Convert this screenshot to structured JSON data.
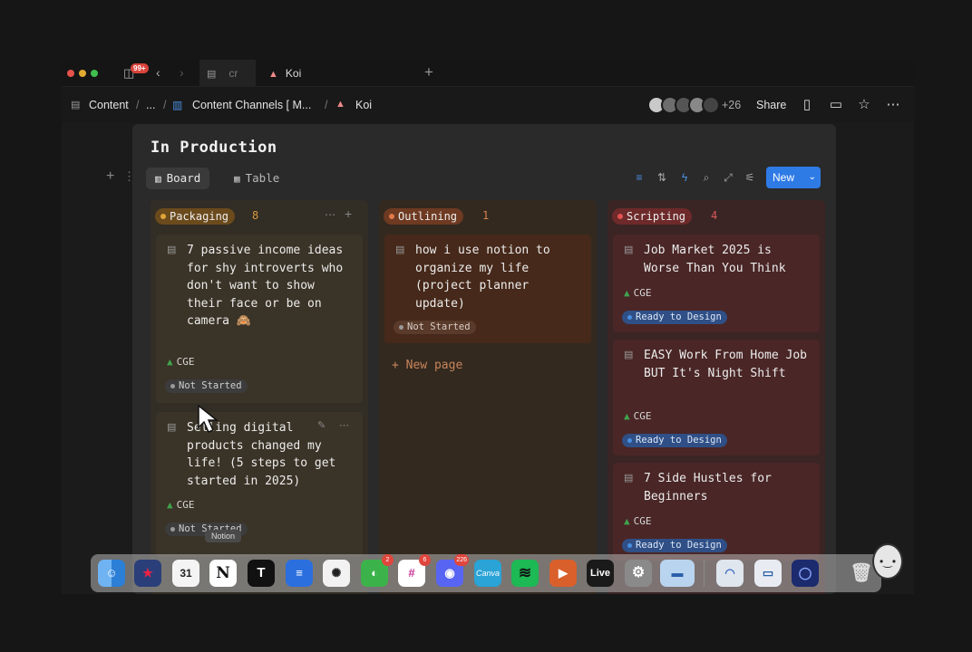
{
  "tabbar": {
    "notifications_badge": "99+",
    "tabs": [
      {
        "label": "cr"
      },
      {
        "label": "Koi"
      }
    ]
  },
  "breadcrumb": {
    "items": [
      "Content",
      "...",
      "Content Channels [ M...",
      "Koi"
    ],
    "extra_collaborators": "+26",
    "share_label": "Share"
  },
  "page": {
    "title": "In Production",
    "views": [
      {
        "label": "Board",
        "active": true
      },
      {
        "label": "Table",
        "active": false
      }
    ],
    "new_button": "New"
  },
  "columns": [
    {
      "name": "Packaging",
      "count": "8",
      "pill_bg": "#6b4a1c",
      "pill_dot": "#e0a53a",
      "count_color": "#d59a3f",
      "col_bg": "#322d25",
      "card_bg": "#3a3327",
      "cards": [
        {
          "title": "7 passive income ideas for shy introverts who don't want to show their face or be on camera 🙈",
          "owner": "CGE",
          "status": "Not Started"
        },
        {
          "title": "Selling digital products changed my life! (5 steps to get started in 2025)",
          "owner": "CGE",
          "status": "Not Started"
        }
      ]
    },
    {
      "name": "Outlining",
      "count": "1",
      "pill_bg": "#6e3a22",
      "pill_dot": "#e07a4a",
      "count_color": "#d9824f",
      "col_bg": "#33291f",
      "card_bg": "#46291a",
      "cards": [
        {
          "title": "how i use notion to organize my life (project planner update)",
          "owner": "",
          "status": "Not Started"
        }
      ],
      "new_page": "+ New page"
    },
    {
      "name": "Scripting",
      "count": "4",
      "pill_bg": "#6e2a2a",
      "pill_dot": "#e05252",
      "count_color": "#d85a5a",
      "col_bg": "#3a2424",
      "card_bg": "#4a2626",
      "cards": [
        {
          "title": "Job Market 2025 is Worse Than You Think",
          "owner": "CGE",
          "status": "Ready to Design"
        },
        {
          "title": "EASY Work From Home Job BUT It's Night Shift",
          "owner": "CGE",
          "status": "Ready to Design"
        },
        {
          "title": "7 Side Hustles for Beginners",
          "owner": "CGE",
          "status": "Ready to Design"
        }
      ]
    }
  ],
  "dock": {
    "tooltip": "Notion",
    "calendar_day": "31",
    "messages_badge": "2",
    "slack_badge": "6",
    "discord_badge": "226",
    "canva_label": "Canva",
    "live_label": "Live"
  }
}
